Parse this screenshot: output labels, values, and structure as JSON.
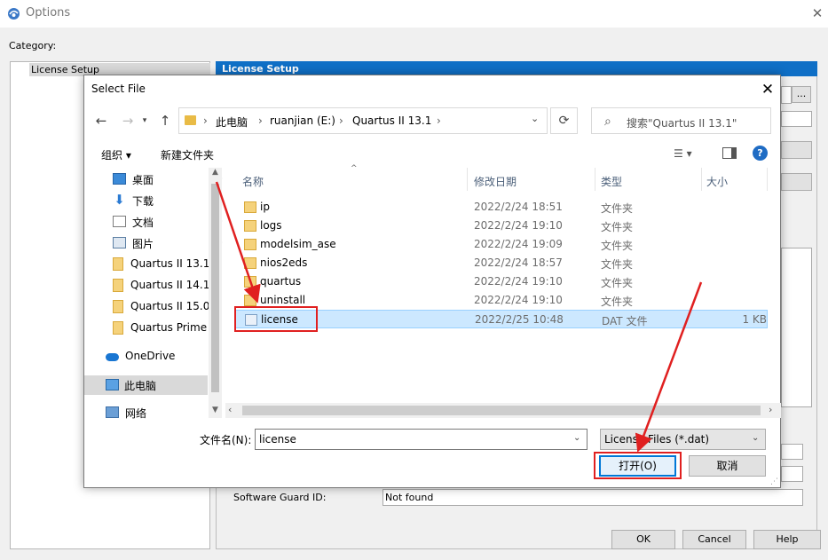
{
  "options_window": {
    "title": "Options",
    "category_label": "Category:",
    "category_items": [
      "License Setup"
    ],
    "panel_header": "License Setup",
    "browse_button": "...",
    "software_guard_label": "Software Guard ID:",
    "software_guard_value": "Not found",
    "buttons": {
      "ok": "OK",
      "cancel": "Cancel",
      "help": "Help"
    }
  },
  "dialog": {
    "title": "Select File",
    "breadcrumb": [
      "此电脑",
      "ruanjian (E:)",
      "Quartus II 13.1"
    ],
    "search_placeholder": "搜索\"Quartus II 13.1\"",
    "toolbar": {
      "organize": "组织 ▾",
      "new_folder": "新建文件夹"
    },
    "nav_items": [
      {
        "label": "桌面",
        "icon": "desktop-icon",
        "pinned": true
      },
      {
        "label": "下载",
        "icon": "download-icon",
        "pinned": true
      },
      {
        "label": "文档",
        "icon": "document-icon",
        "pinned": true
      },
      {
        "label": "图片",
        "icon": "picture-icon",
        "pinned": true
      },
      {
        "label": "Quartus II 13.1",
        "icon": "folder-icon",
        "pinned": false
      },
      {
        "label": "Quartus II 14.1",
        "icon": "folder-icon",
        "pinned": false
      },
      {
        "label": "Quartus II 15.0",
        "icon": "folder-icon",
        "pinned": false
      },
      {
        "label": "Quartus Prime",
        "icon": "folder-icon",
        "pinned": false
      },
      {
        "label": "OneDrive",
        "icon": "cloud-icon",
        "pinned": false
      },
      {
        "label": "此电脑",
        "icon": "computer-icon",
        "pinned": false,
        "selected": true
      },
      {
        "label": "网络",
        "icon": "network-icon",
        "pinned": false
      }
    ],
    "columns": {
      "name": "名称",
      "date": "修改日期",
      "type": "类型",
      "size": "大小"
    },
    "files": [
      {
        "name": "ip",
        "date": "2022/2/24 18:51",
        "type": "文件夹",
        "size": "",
        "kind": "folder"
      },
      {
        "name": "logs",
        "date": "2022/2/24 19:10",
        "type": "文件夹",
        "size": "",
        "kind": "folder"
      },
      {
        "name": "modelsim_ase",
        "date": "2022/2/24 19:09",
        "type": "文件夹",
        "size": "",
        "kind": "folder"
      },
      {
        "name": "nios2eds",
        "date": "2022/2/24 18:57",
        "type": "文件夹",
        "size": "",
        "kind": "folder"
      },
      {
        "name": "quartus",
        "date": "2022/2/24 19:10",
        "type": "文件夹",
        "size": "",
        "kind": "folder"
      },
      {
        "name": "uninstall",
        "date": "2022/2/24 19:10",
        "type": "文件夹",
        "size": "",
        "kind": "folder"
      },
      {
        "name": "license",
        "date": "2022/2/25 10:48",
        "type": "DAT 文件",
        "size": "1 KB",
        "kind": "file",
        "selected": true
      }
    ],
    "filename_label": "文件名(N):",
    "filename_value": "license",
    "filter_value": "License Files (*.dat)",
    "open_button": "打开(O)",
    "cancel_button": "取消"
  },
  "colors": {
    "panel_header_blue": "#0f6fc6",
    "selection_blue": "#cce8ff",
    "annotation_red": "#e02020",
    "folder_yellow": "#f5d27b"
  }
}
